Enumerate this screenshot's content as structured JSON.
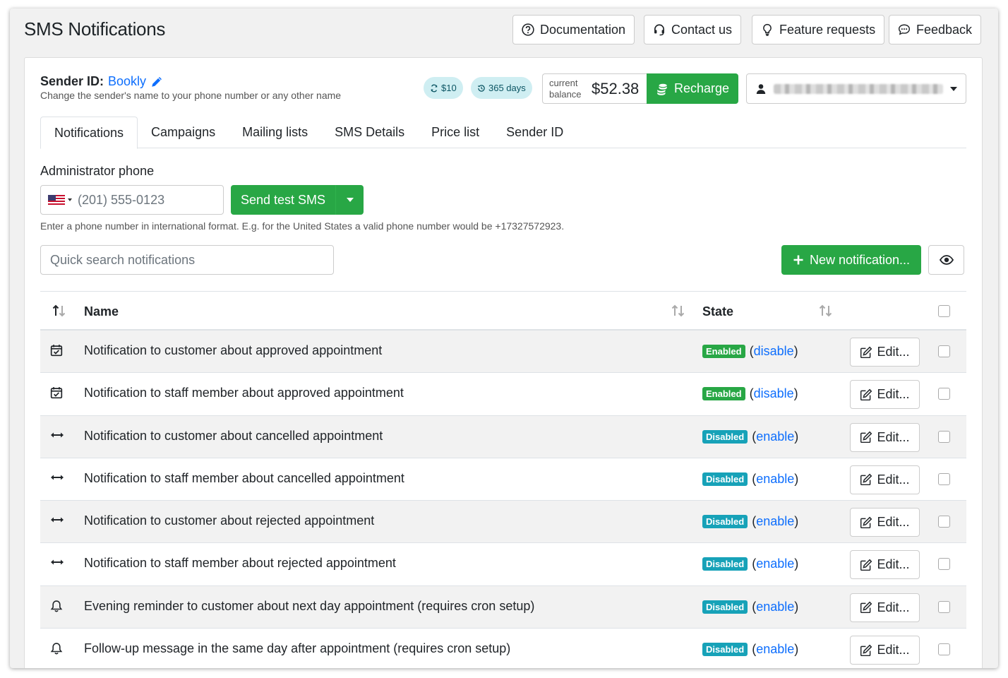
{
  "header": {
    "title": "SMS Notifications",
    "buttons": {
      "documentation": "Documentation",
      "contact": "Contact us",
      "feature_requests": "Feature requests",
      "feedback": "Feedback"
    }
  },
  "sender": {
    "label": "Sender ID:",
    "name": "Bookly",
    "description": "Change the sender's name to your phone number or any other name"
  },
  "pills": {
    "auto_recharge": "$10",
    "period": "365 days"
  },
  "balance": {
    "label": "current balance",
    "value": "$52.38",
    "recharge_label": "Recharge"
  },
  "tabs": [
    "Notifications",
    "Campaigns",
    "Mailing lists",
    "SMS Details",
    "Price list",
    "Sender ID"
  ],
  "admin_phone": {
    "label": "Administrator phone",
    "placeholder": "(201) 555-0123",
    "send_label": "Send test SMS",
    "help": "Enter a phone number in international format. E.g. for the United States a valid phone number would be +17327572923."
  },
  "search": {
    "placeholder": "Quick search notifications"
  },
  "new_notification_label": "New notification...",
  "table": {
    "columns": {
      "name": "Name",
      "state": "State"
    },
    "edit_label": "Edit...",
    "rows": [
      {
        "icon": "calendar-check-icon",
        "name": "Notification to customer about approved appointment",
        "state": "Enabled",
        "action": "disable"
      },
      {
        "icon": "calendar-check-icon",
        "name": "Notification to staff member about approved appointment",
        "state": "Enabled",
        "action": "disable"
      },
      {
        "icon": "arrows-horizontal-icon",
        "name": "Notification to customer about cancelled appointment",
        "state": "Disabled",
        "action": "enable"
      },
      {
        "icon": "arrows-horizontal-icon",
        "name": "Notification to staff member about cancelled appointment",
        "state": "Disabled",
        "action": "enable"
      },
      {
        "icon": "arrows-horizontal-icon",
        "name": "Notification to customer about rejected appointment",
        "state": "Disabled",
        "action": "enable"
      },
      {
        "icon": "arrows-horizontal-icon",
        "name": "Notification to staff member about rejected appointment",
        "state": "Disabled",
        "action": "enable"
      },
      {
        "icon": "bell-icon",
        "name": "Evening reminder to customer about next day appointment (requires cron setup)",
        "state": "Disabled",
        "action": "enable"
      },
      {
        "icon": "bell-icon",
        "name": "Follow-up message in the same day after appointment (requires cron setup)",
        "state": "Disabled",
        "action": "enable"
      }
    ]
  },
  "colors": {
    "primary_green": "#28a745",
    "info_cyan": "#17a2b8",
    "link_blue": "#0d6efd"
  }
}
